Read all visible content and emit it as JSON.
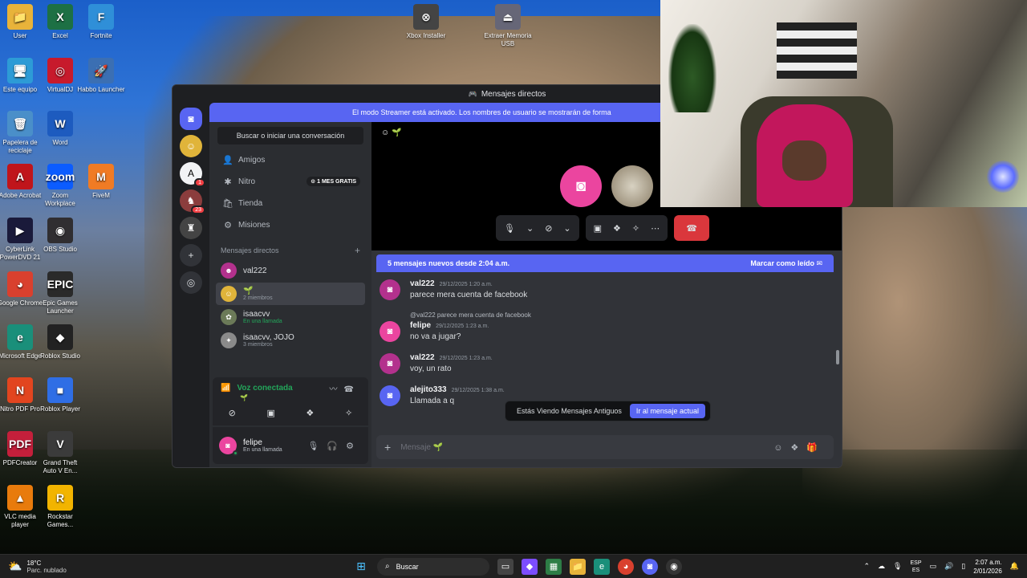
{
  "desktop": {
    "icons": [
      {
        "id": "user",
        "label": "User",
        "glyph": "📁",
        "color": "#e8b33a"
      },
      {
        "id": "excel",
        "label": "Excel",
        "glyph": "X",
        "color": "#1d7044"
      },
      {
        "id": "fortnite",
        "label": "Fortnite",
        "glyph": "F",
        "color": "#2f8fd8"
      },
      {
        "id": "este-equipo",
        "label": "Este equipo",
        "glyph": "🖥",
        "color": "#2d9bd6"
      },
      {
        "id": "virtualdj",
        "label": "VirtualDJ",
        "glyph": "◎",
        "color": "#c71a2c"
      },
      {
        "id": "habbo",
        "label": "Habbo Launcher",
        "glyph": "🚀",
        "color": "#3b6fb3"
      },
      {
        "id": "papelera",
        "label": "Papelera de reciclaje",
        "glyph": "🗑",
        "color": "#4a8fc9"
      },
      {
        "id": "word",
        "label": "Word",
        "glyph": "W",
        "color": "#1d5bbf"
      },
      {
        "id": "acrobat",
        "label": "Adobe Acrobat",
        "glyph": "A",
        "color": "#c0151b"
      },
      {
        "id": "zoom",
        "label": "Zoom Workplace",
        "glyph": "zoom",
        "color": "#0b5cff"
      },
      {
        "id": "fivem",
        "label": "FiveM",
        "glyph": "M",
        "color": "#f07b24"
      },
      {
        "id": "powerdvd",
        "label": "CyberLink PowerDVD 21",
        "glyph": "▶",
        "color": "#1a1a3a"
      },
      {
        "id": "obs",
        "label": "OBS Studio",
        "glyph": "◉",
        "color": "#302e31"
      },
      {
        "id": "chrome",
        "label": "Google Chrome",
        "glyph": "◕",
        "color": "#d9402e"
      },
      {
        "id": "epic",
        "label": "Epic Games Launcher",
        "glyph": "EPIC",
        "color": "#2a2a2a"
      },
      {
        "id": "edge",
        "label": "Microsoft Edge",
        "glyph": "e",
        "color": "#1a8f7a"
      },
      {
        "id": "roblox-studio",
        "label": "Roblox Studio",
        "glyph": "◆",
        "color": "#222"
      },
      {
        "id": "nitro",
        "label": "Nitro PDF Pro",
        "glyph": "N",
        "color": "#e2451f"
      },
      {
        "id": "roblox-player",
        "label": "Roblox Player",
        "glyph": "■",
        "color": "#2f6ee5"
      },
      {
        "id": "pdfcreator",
        "label": "PDFCreator",
        "glyph": "PDF",
        "color": "#c41f3b"
      },
      {
        "id": "gta",
        "label": "Grand Theft Auto V En...",
        "glyph": "V",
        "color": "#3b3b3b"
      },
      {
        "id": "vlc",
        "label": "VLC media player",
        "glyph": "▲",
        "color": "#e87b0c"
      },
      {
        "id": "rockstar",
        "label": "Rockstar Games...",
        "glyph": "R",
        "color": "#f2b400"
      },
      {
        "id": "xbox",
        "label": "Xbox Installer",
        "glyph": "⊗",
        "color": "#444"
      },
      {
        "id": "usb",
        "label": "Extraer Memoria USB",
        "glyph": "⏏",
        "color": "#667"
      }
    ]
  },
  "discord": {
    "window_title": "Mensajes directos",
    "streamer_banner": "El modo Streamer está activado. Los nombres de usuario se mostrarán de forma",
    "rail_badges": [
      "1",
      "23"
    ],
    "search_placeholder": "Buscar o iniciar una conversación",
    "nav": {
      "friends": "Amigos",
      "nitro": "Nitro",
      "nitro_pill": "1 MES GRATIS",
      "shop": "Tienda",
      "missions": "Misiones"
    },
    "dm_header": "Mensajes directos",
    "dms": [
      {
        "name": "val222",
        "sub": "",
        "green": false,
        "active": false,
        "color": "#b3318d",
        "glyph": "☻"
      },
      {
        "name": "🌱",
        "sub": "2 miembros",
        "green": false,
        "active": true,
        "color": "#e0b43a",
        "glyph": "☺"
      },
      {
        "name": "isaacvv",
        "sub": "En una llamada",
        "green": true,
        "active": false,
        "color": "#6b7a58",
        "glyph": "✿"
      },
      {
        "name": "isaacvv, JOJO",
        "sub": "3 miembros",
        "green": false,
        "active": false,
        "color": "#8a8a8a",
        "glyph": "✦"
      }
    ],
    "voice": {
      "status": "Voz conectada",
      "channel": "🌱"
    },
    "user": {
      "name": "felipe",
      "status": "En una llamada"
    },
    "call": {
      "header": "🌱"
    },
    "new_messages": {
      "text": "5 mensajes nuevos desde 2:04 a.m.",
      "mark_read": "Marcar como leído"
    },
    "messages": [
      {
        "author": "val222",
        "time": "29/12/2025 1:20 a.m.",
        "text": "parece mera cuenta de facebook",
        "color": "#b3318d",
        "reply": ""
      },
      {
        "author": "felipe",
        "time": "29/12/2025 1:23 a.m.",
        "text": "no va a jugar?",
        "color": "#eb459f",
        "reply": "@val222 parece mera cuenta de facebook"
      },
      {
        "author": "val222",
        "time": "29/12/2025 1:23 a.m.",
        "text": "voy, un rato",
        "color": "#b3318d",
        "reply": ""
      },
      {
        "author": "alejito333",
        "time": "29/12/2025 1:38 a.m.",
        "text": "Llamada a q",
        "color": "#5865f2",
        "reply": ""
      }
    ],
    "old_messages_toast": {
      "text": "Estás Viendo Mensajes Antiguos",
      "button": "Ir al mensaje actual"
    },
    "composer_placeholder": "Mensaje 🌱"
  },
  "taskbar": {
    "weather_temp": "18°C",
    "weather_desc": "Parc. nublado",
    "search": "Buscar",
    "lang_top": "ESP",
    "lang_bottom": "ES",
    "time": "2:07 a.m.",
    "date": "2/01/2026"
  }
}
